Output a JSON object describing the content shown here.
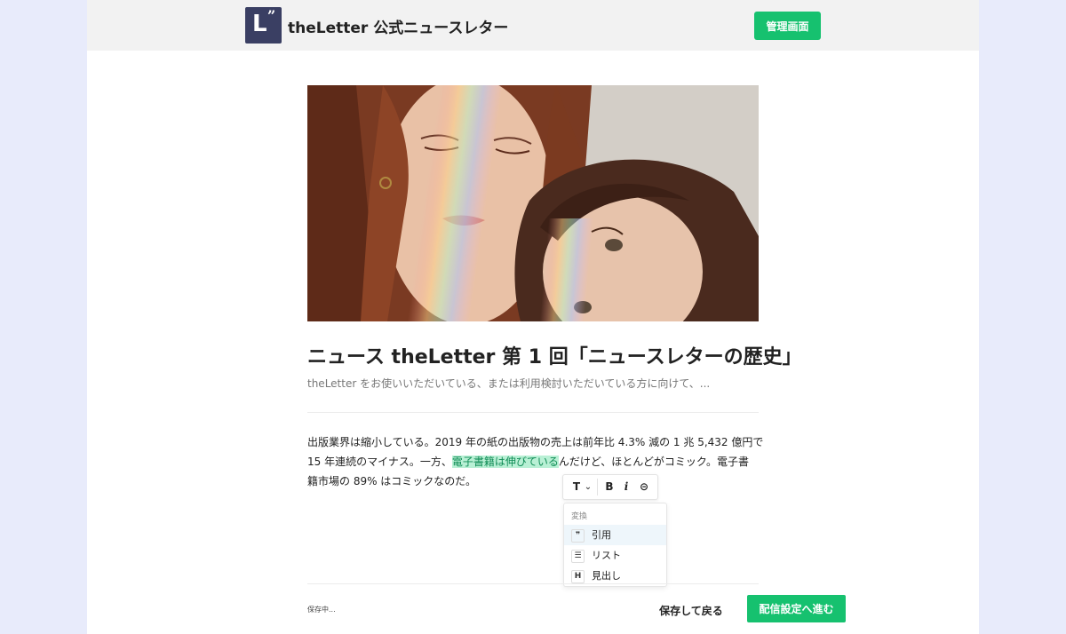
{
  "header": {
    "brand_title": "theLetter 公式ニュースレター",
    "admin_button": "管理画面"
  },
  "article": {
    "title": "ニュース theLetter 第 1 回「ニュースレターの歴史」",
    "subtitle": "theLetter をお使いいただいている、または利用検討いただいている方に向けて、...",
    "body": {
      "line1": "出版業界は縮小している。2019 年の紙の出版物の売上は前年比 4.3% 減の 1 兆 5,432 億円で",
      "line2_before": "15 年連続のマイナス。一方、",
      "line2_highlight": "電子書籍は伸びている",
      "line2_after": "んだけど、ほとんどがコミック。電子書",
      "line3": "籍市場の 89% はコミックなのだ。"
    }
  },
  "toolbar": {
    "text_type": "T",
    "chevron": "⌄",
    "bold": "B",
    "italic": "i",
    "link": "⊝"
  },
  "convert_menu": {
    "heading": "変換",
    "items": [
      {
        "icon": "❞",
        "label": "引用"
      },
      {
        "icon": "☰",
        "label": "リスト"
      },
      {
        "icon": "H",
        "label": "見出し"
      }
    ]
  },
  "footer": {
    "status": "保存中...",
    "save_back": "保存して戻る",
    "next": "配信設定へ進む"
  },
  "colors": {
    "accent": "#16c16f",
    "logo_bg": "#3a3f63",
    "highlight_bg": "#b9f0d5",
    "highlight_text": "#0f8c55"
  }
}
